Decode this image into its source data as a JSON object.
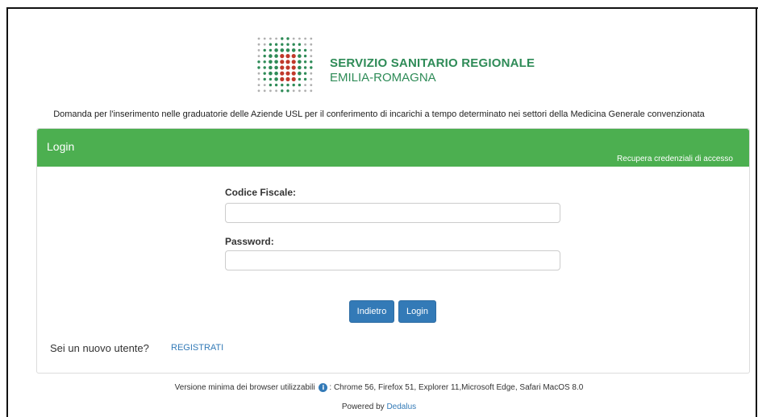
{
  "logo": {
    "title": "SERVIZIO SANITARIO REGIONALE",
    "subtitle": "EMILIA-ROMAGNA",
    "colors": {
      "green": "#2e8b57",
      "red": "#c0392b",
      "gray": "#b0b0b0"
    }
  },
  "page": {
    "subtitle": "Domanda per l'inserimento nelle graduatorie delle Aziende USL per il conferimento di incarichi a tempo determinato nei settori della Medicina Generale convenzionata"
  },
  "panel": {
    "title": "Login",
    "recover_link": "Recupera credenziali di accesso",
    "header_color": "#4caf50"
  },
  "form": {
    "codice_label": "Codice Fiscale:",
    "codice_value": "",
    "password_label": "Password:",
    "password_value": ""
  },
  "buttons": {
    "back_label": "Indietro",
    "login_label": "Login",
    "color": "#337ab7"
  },
  "register": {
    "prompt": "Sei un nuovo utente?",
    "link": "REGISTRATI"
  },
  "footer": {
    "browser_prefix": "Versione minima dei browser utilizzabili",
    "info_icon": "info-icon",
    "browser_list": ": Chrome 56, Firefox 51, Explorer 11,Microsoft Edge, Safari MacOS 8.0",
    "powered_prefix": "Powered by",
    "powered_link": "Dedalus"
  }
}
